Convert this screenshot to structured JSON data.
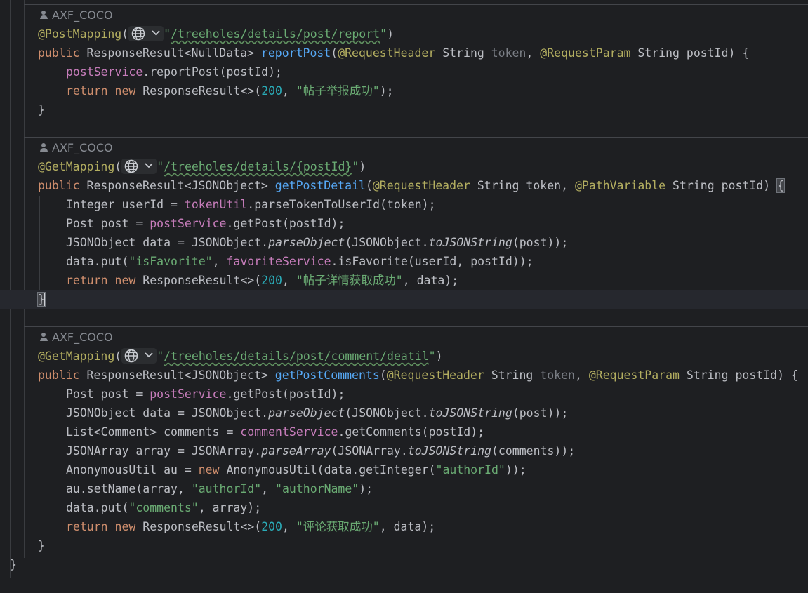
{
  "methods": [
    {
      "author": "AXF_COCO",
      "annotation": "@PostMapping",
      "path": "/treeholes/details/post/report",
      "signature": {
        "public": "public",
        "type": "ResponseResult<NullData>",
        "name": "reportPost",
        "p1_ann": "@RequestHeader",
        "p1_type": "String",
        "p1_name": "token",
        "p2_ann": "@RequestParam",
        "p2_type": "String",
        "p2_name": "postId"
      },
      "body": {
        "l1_field": "postService",
        "l1_rest": ".reportPost(postId);",
        "l2_return": "return",
        "l2_new": "new",
        "l2_type": "ResponseResult<>(",
        "l2_num": "200",
        "l2_str": "\"帖子举报成功\"",
        "l2_end": ");"
      }
    },
    {
      "author": "AXF_COCO",
      "annotation": "@GetMapping",
      "path": "/treeholes/details/{postId}",
      "signature": {
        "public": "public",
        "type": "ResponseResult<JSONObject>",
        "name": "getPostDetail",
        "p1_ann": "@RequestHeader",
        "p1_type": "String",
        "p1_name": "token",
        "p2_ann": "@PathVariable",
        "p2_type": "String",
        "p2_name": "postId"
      },
      "body": {
        "l1_a": "Integer userId = ",
        "l1_field": "tokenUtil",
        "l1_b": ".parseTokenToUserId(token);",
        "l2_a": "Post post = ",
        "l2_field": "postService",
        "l2_b": ".getPost(postId);",
        "l3_a": "JSONObject data = JSONObject.",
        "l3_m1": "parseObject",
        "l3_b": "(JSONObject.",
        "l3_m2": "toJSONString",
        "l3_c": "(post));",
        "l4_a": "data.put(",
        "l4_str": "\"isFavorite\"",
        "l4_b": ", ",
        "l4_field": "favoriteService",
        "l4_c": ".isFavorite(userId, postId));",
        "l5_return": "return",
        "l5_new": "new",
        "l5_type": "ResponseResult<>(",
        "l5_num": "200",
        "l5_str": "\"帖子详情获取成功\"",
        "l5_end": ", data);"
      }
    },
    {
      "author": "AXF_COCO",
      "annotation": "@GetMapping",
      "path": "/treeholes/details/post/comment/deatil",
      "signature": {
        "public": "public",
        "type": "ResponseResult<JSONObject>",
        "name": "getPostComments",
        "p1_ann": "@RequestHeader",
        "p1_type": "String",
        "p1_name": "token",
        "p2_ann": "@RequestParam",
        "p2_type": "String",
        "p2_name": "postId"
      },
      "body": {
        "l1_a": "Post post = ",
        "l1_field": "postService",
        "l1_b": ".getPost(postId);",
        "l2_a": "JSONObject data = JSONObject.",
        "l2_m1": "parseObject",
        "l2_b": "(JSONObject.",
        "l2_m2": "toJSONString",
        "l2_c": "(post));",
        "l3_a": "List<Comment> comments = ",
        "l3_field": "commentService",
        "l3_b": ".getComments(postId);",
        "l4_a": "JSONArray array = JSONArray.",
        "l4_m1": "parseArray",
        "l4_b": "(JSONArray.",
        "l4_m2": "toJSONString",
        "l4_c": "(comments));",
        "l5_a": "AnonymousUtil au = ",
        "l5_new": "new",
        "l5_b": " AnonymousUtil(data.getInteger(",
        "l5_str": "\"authorId\"",
        "l5_c": "));",
        "l6_a": "au.setName(array, ",
        "l6_str1": "\"authorId\"",
        "l6_b": ", ",
        "l6_str2": "\"authorName\"",
        "l6_c": ");",
        "l7_a": "data.put(",
        "l7_str": "\"comments\"",
        "l7_b": ", array);",
        "l8_return": "return",
        "l8_new": "new",
        "l8_type": "ResponseResult<>(",
        "l8_num": "200",
        "l8_str": "\"评论获取成功\"",
        "l8_end": ", data);"
      }
    }
  ],
  "symbols": {
    "open_paren": "(",
    "close_paren": ")",
    "quote": "\"",
    "open_brace": "{",
    "close_brace": "}",
    "comma_space": ", ",
    "space": " ",
    "paren_brace": ") {"
  },
  "icons": {
    "author": "person-icon",
    "endpoint": "globe-icon",
    "dropdown": "chevron-down-icon"
  },
  "colors": {
    "background": "#1e1f22",
    "annotation": "#b3ae60",
    "keyword": "#cf8e6d",
    "method": "#56a8f5",
    "field": "#c77dbb",
    "number": "#2aacb8",
    "string": "#6aab73"
  }
}
